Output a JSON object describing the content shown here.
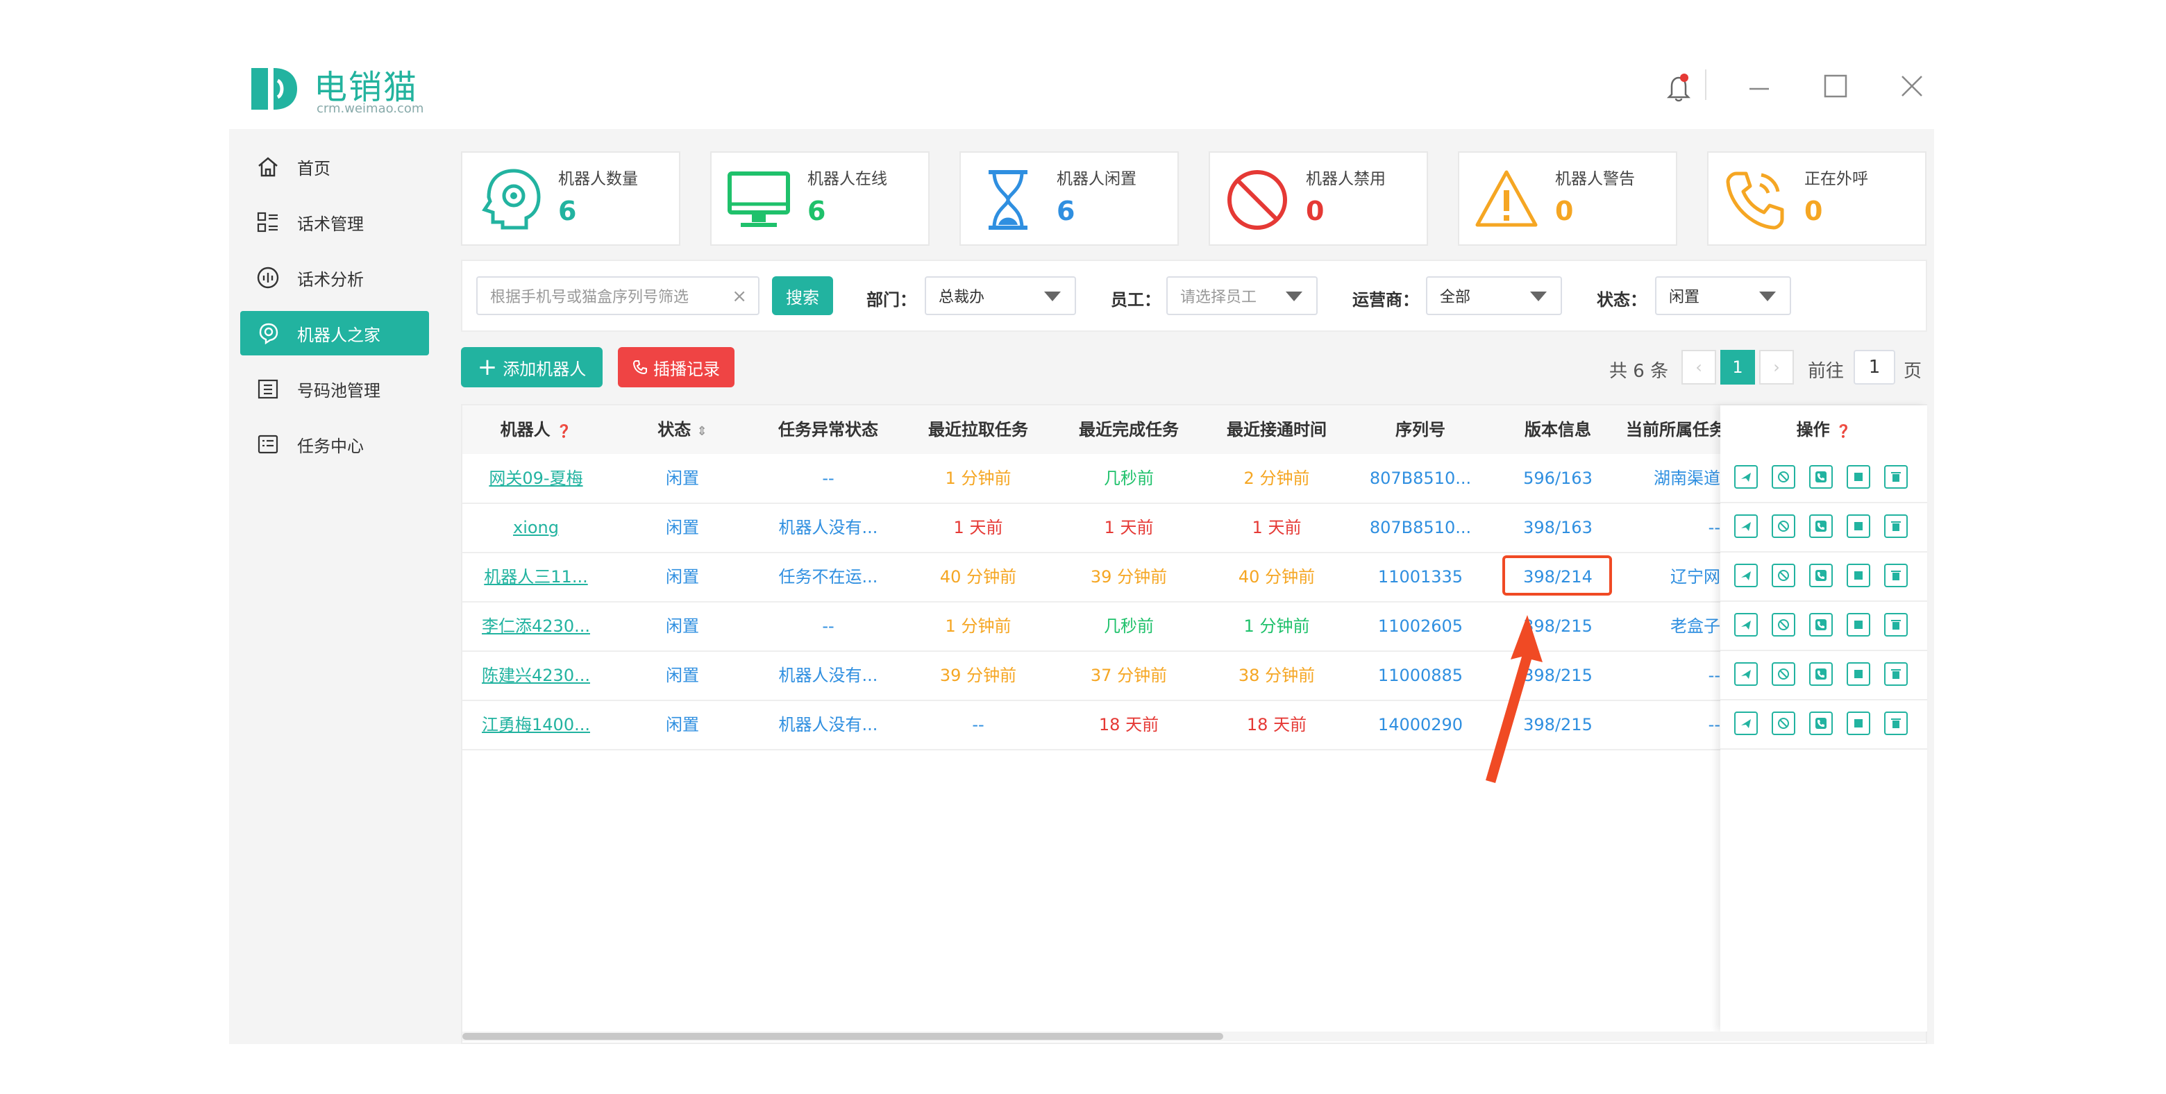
{
  "app": {
    "name": "电销猫",
    "url": "crm.weimao.com"
  },
  "sidebar": {
    "items": [
      {
        "label": "首页",
        "icon": "home-icon"
      },
      {
        "label": "话术管理",
        "icon": "script-list-icon"
      },
      {
        "label": "话术分析",
        "icon": "analysis-icon"
      },
      {
        "label": "机器人之家",
        "icon": "robot-home-icon",
        "active": true
      },
      {
        "label": "号码池管理",
        "icon": "number-pool-icon"
      },
      {
        "label": "任务中心",
        "icon": "task-center-icon"
      }
    ]
  },
  "stats": [
    {
      "label": "机器人数量",
      "value": "6",
      "color": "#22b3a0",
      "icon": "robot-head-icon"
    },
    {
      "label": "机器人在线",
      "value": "6",
      "color": "#1fc16b",
      "icon": "monitor-icon"
    },
    {
      "label": "机器人闲置",
      "value": "6",
      "color": "#2f8fe0",
      "icon": "hourglass-icon"
    },
    {
      "label": "机器人禁用",
      "value": "0",
      "color": "#e53935",
      "icon": "ban-icon"
    },
    {
      "label": "机器人警告",
      "value": "0",
      "color": "#f5a623",
      "icon": "warning-icon"
    },
    {
      "label": "正在外呼",
      "value": "0",
      "color": "#f5a623",
      "icon": "phone-calling-icon"
    }
  ],
  "filters": {
    "search_placeholder": "根据手机号或猫盒序列号筛选",
    "search_button": "搜索",
    "dept_label": "部门：",
    "dept_value": "总裁办",
    "staff_label": "员工：",
    "staff_placeholder": "请选择员工",
    "carrier_label": "运营商：",
    "carrier_value": "全部",
    "status_label": "状态：",
    "status_value": "闲置"
  },
  "actions": {
    "add_robot": "添加机器人",
    "call_record": "插播记录"
  },
  "pagination": {
    "total": "共 6 条",
    "current": "1",
    "goto_label": "前往",
    "goto_value": "1",
    "page_suffix": "页"
  },
  "table": {
    "headers": [
      "机器人",
      "状态",
      "任务异常状态",
      "最近拉取任务",
      "最近完成任务",
      "最近接通时间",
      "序列号",
      "版本信息",
      "当前所属任务",
      "操作"
    ],
    "rows": [
      {
        "robot": "网关09-夏梅",
        "status": "闲置",
        "task_error": "--",
        "last_pull": "1 分钟前",
        "last_done": "几秒前",
        "last_connect": "2 分钟前",
        "serial": "807B8510...",
        "version": "596/163",
        "task": "湖南渠道",
        "task_color": "#2f8fe0"
      },
      {
        "robot": "xiong",
        "status": "闲置",
        "task_error": "机器人没有...",
        "last_pull": "1 天前",
        "last_done": "1 天前",
        "last_connect": "1 天前",
        "serial": "807B8510...",
        "version": "398/163",
        "task": "--",
        "task_color": "#2f8fe0"
      },
      {
        "robot": "机器人三11...",
        "status": "闲置",
        "task_error": "任务不在运...",
        "last_pull": "40 分钟前",
        "last_done": "39 分钟前",
        "last_connect": "40 分钟前",
        "serial": "11001335",
        "version": "398/214",
        "task": "辽宁网",
        "task_color": "#2f8fe0",
        "highlight": true
      },
      {
        "robot": "李仁添4230...",
        "status": "闲置",
        "task_error": "--",
        "last_pull": "1 分钟前",
        "last_done": "几秒前",
        "last_connect": "1 分钟前",
        "serial": "11002605",
        "version": "398/215",
        "task": "老盒子",
        "task_color": "#2f8fe0"
      },
      {
        "robot": "陈建兴4230...",
        "status": "闲置",
        "task_error": "机器人没有...",
        "last_pull": "39 分钟前",
        "last_done": "37 分钟前",
        "last_connect": "38 分钟前",
        "serial": "11000885",
        "version": "398/215",
        "task": "--",
        "task_color": "#2f8fe0"
      },
      {
        "robot": "江勇梅1400...",
        "status": "闲置",
        "task_error": "机器人没有...",
        "last_pull": "--",
        "last_done": "18 天前",
        "last_connect": "18 天前",
        "serial": "14000290",
        "version": "398/215",
        "task": "--",
        "task_color": "#2f8fe0"
      }
    ],
    "row_colors": {
      "robot": "#22b3a0",
      "status": "#2f8fe0",
      "task_error": "#2f8fe0",
      "serial": "#2f8fe0",
      "version": "#2f8fe0"
    },
    "time_colors": {
      "row0": [
        "#f5a623",
        "#1fc16b",
        "#f5a623"
      ],
      "row1": [
        "#e53935",
        "#e53935",
        "#e53935"
      ],
      "row2": [
        "#f5a623",
        "#f5a623",
        "#f5a623"
      ],
      "row3": [
        "#f5a623",
        "#1fc16b",
        "#1fc16b"
      ],
      "row4": [
        "#f5a623",
        "#f5a623",
        "#f5a623"
      ],
      "row5": [
        "#2f8fe0",
        "#e53935",
        "#e53935"
      ]
    },
    "op_icons": [
      "send-icon",
      "disable-icon",
      "call-icon",
      "stop-icon",
      "delete-icon"
    ]
  },
  "accent": "#22b3a0",
  "highlight_color": "#f04a24"
}
